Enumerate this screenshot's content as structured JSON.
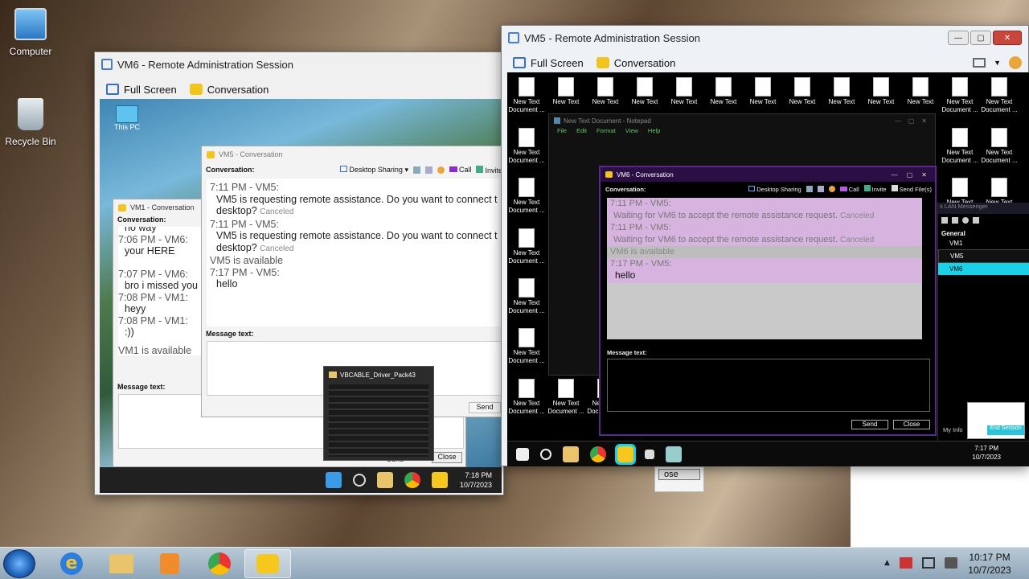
{
  "desktop": {
    "icons": [
      {
        "label": "Computer"
      },
      {
        "label": "Recycle Bin"
      }
    ]
  },
  "vm6_window": {
    "title": "VM6 - Remote Administration Session",
    "toolbar": {
      "full_screen": "Full Screen",
      "conversation": "Conversation"
    },
    "inner_desktop_icon": "This PC",
    "vm5_conversation": {
      "title": "VM5 - Conversation",
      "conversation_label": "Conversation:",
      "tools": {
        "desktop_sharing": "Desktop Sharing",
        "call": "Call",
        "invite": "Invite"
      },
      "messages": [
        {
          "header": "7:11 PM - VM5:",
          "text": "VM5 is requesting remote assistance. Do you want to connect t",
          "text2": "desktop?",
          "tag": "Canceled"
        },
        {
          "header": "7:11 PM - VM5:",
          "text": "VM5 is requesting remote assistance. Do you want to connect t",
          "text2": "desktop?",
          "tag": "Canceled"
        },
        {
          "status": "VM5 is available"
        },
        {
          "header": "7:17 PM - VM5:",
          "text": "hello"
        }
      ],
      "message_text_label": "Message text:",
      "send": "Send"
    },
    "vm1_conversation": {
      "title": "VM1 - Conversation",
      "conversation_label": "Conversation:",
      "lines": [
        {
          "header": "",
          "text": "no way"
        },
        {
          "header": "7:06 PM - VM6:",
          "text": "your HERE"
        },
        {
          "header": "7:07 PM - VM6:",
          "text": "bro i missed you"
        },
        {
          "header": "7:08 PM - VM1:",
          "text": "heyy"
        },
        {
          "header": "7:08 PM - VM1:",
          "text": ":))"
        }
      ],
      "status": "VM1 is available",
      "message_text_label": "Message text:",
      "send": "Send",
      "close": "Close"
    },
    "thumbnail_title": "VBCABLE_Driver_Pack43",
    "taskbar": {
      "time": "7:18 PM",
      "date": "10/7/2023"
    }
  },
  "vm5_window": {
    "title": "VM5 - Remote Administration Session",
    "toolbar": {
      "full_screen": "Full Screen",
      "conversation": "Conversation"
    },
    "file_icon_label": "New Text Document",
    "notepad": {
      "title": "New Text Document - Notepad",
      "menu": [
        "File",
        "Edit",
        "Format",
        "View",
        "Help"
      ]
    },
    "vm6_conversation": {
      "title": "VM6 - Conversation",
      "conversation_label": "Conversation:",
      "tools": {
        "desktop_sharing": "Desktop Sharing",
        "call": "Call",
        "invite": "Invite",
        "send_files": "Send File(s)"
      },
      "messages": [
        {
          "header": "7:11 PM - VM5:",
          "text": "Waiting for VM6 to accept the remote assistance request.",
          "tag": "Canceled"
        },
        {
          "header": "7:11 PM - VM5:",
          "text": "Waiting for VM6 to accept the remote assistance request.",
          "tag": "Canceled"
        },
        {
          "status": "VM6 is available"
        },
        {
          "header": "7:17 PM - VM5:",
          "text": "hello"
        }
      ],
      "message_text_label": "Message text:",
      "send": "Send",
      "close": "Close"
    },
    "lan_messenger": {
      "title": "s LAN Messenger",
      "group": "General",
      "users": [
        "VM1",
        "VM5",
        "VM6"
      ],
      "my_info": "My Info",
      "end_session": "End Session"
    },
    "taskbar": {
      "time": "7:17 PM",
      "date": "10/7/2023"
    }
  },
  "background_close_label": "ose",
  "taskbar": {
    "time": "10:17 PM",
    "date": "10/7/2023"
  }
}
